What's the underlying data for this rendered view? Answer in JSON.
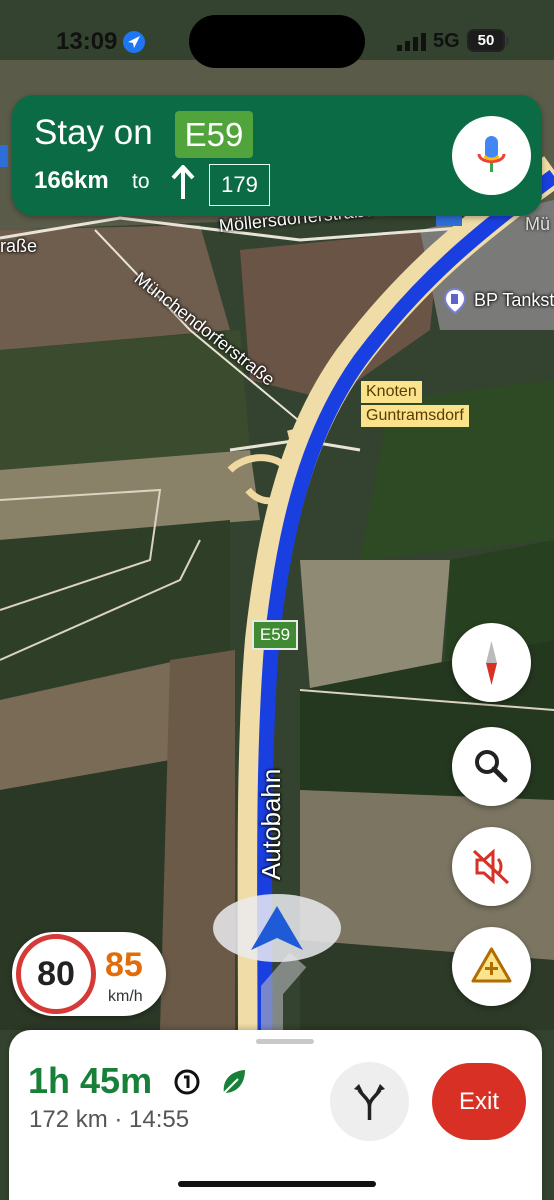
{
  "status_bar": {
    "time": "13:09",
    "network": "5G",
    "battery": "50"
  },
  "banner": {
    "instruction": "Stay on",
    "route": "E59",
    "distance": "166km",
    "to_label": "to",
    "exit_number": "179"
  },
  "map": {
    "streets": {
      "street_a": "raße",
      "street_b": "Möllersdorferstraße",
      "street_c": "Münchendorferstraße"
    },
    "poi": "BP Tankste",
    "junction": {
      "line1": "Knoten",
      "line2": "Guntramsdorf"
    },
    "road_shield": "E59",
    "road_name": "Autobahn",
    "corner_text": "Mü"
  },
  "speed": {
    "limit": "80",
    "current": "85",
    "unit": "km/h"
  },
  "trip": {
    "eta_hours": "1h",
    "eta_minutes": "45m",
    "distance": "172 km",
    "separator": "·",
    "arrival_time": "14:55",
    "exit_label": "Exit"
  },
  "colors": {
    "banner": "#0b6b44",
    "route_blue": "#1a3fe0",
    "eta_green": "#188038",
    "speed_orange": "#e36c0a",
    "exit_red": "#d93025"
  }
}
